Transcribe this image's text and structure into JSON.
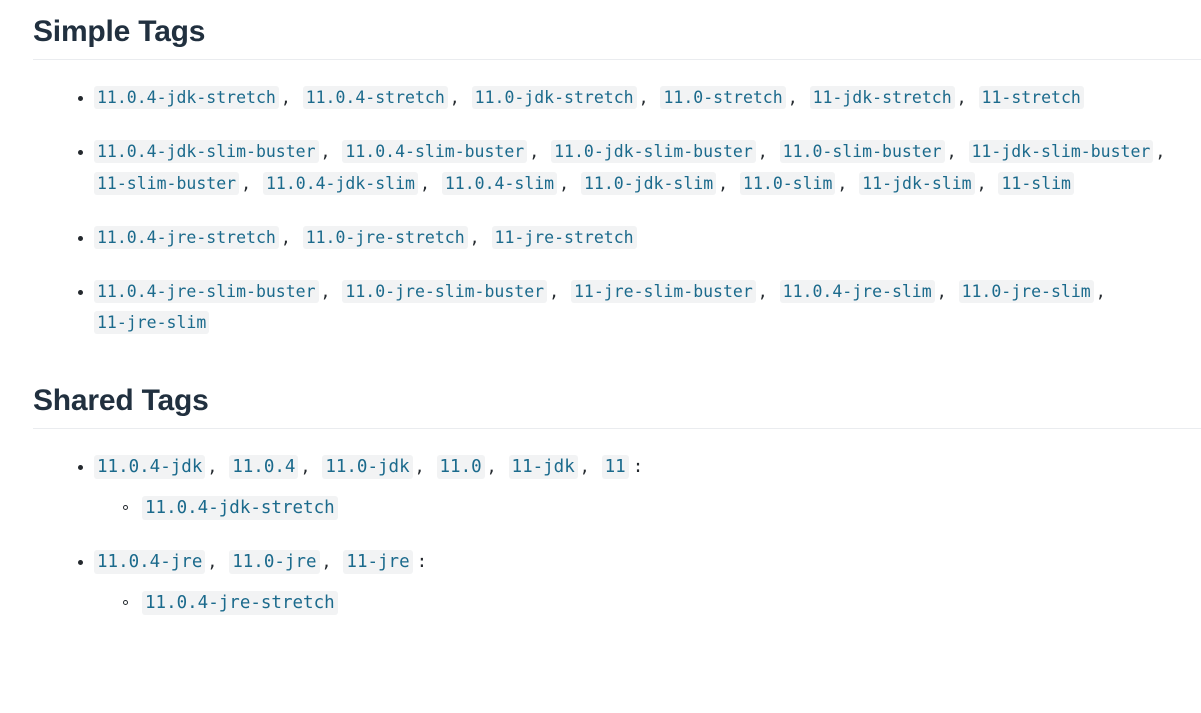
{
  "sections": [
    {
      "id": "simple-tags",
      "heading": "Simple Tags",
      "groups": [
        {
          "tags": [
            "11.0.4-jdk-stretch",
            "11.0.4-stretch",
            "11.0-jdk-stretch",
            "11.0-stretch",
            "11-jdk-stretch",
            "11-stretch"
          ]
        },
        {
          "tags": [
            "11.0.4-jdk-slim-buster",
            "11.0.4-slim-buster",
            "11.0-jdk-slim-buster",
            "11.0-slim-buster",
            "11-jdk-slim-buster",
            "11-slim-buster",
            "11.0.4-jdk-slim",
            "11.0.4-slim",
            "11.0-jdk-slim",
            "11.0-slim",
            "11-jdk-slim",
            "11-slim"
          ]
        },
        {
          "tags": [
            "11.0.4-jre-stretch",
            "11.0-jre-stretch",
            "11-jre-stretch"
          ]
        },
        {
          "tags": [
            "11.0.4-jre-slim-buster",
            "11.0-jre-slim-buster",
            "11-jre-slim-buster",
            "11.0.4-jre-slim",
            "11.0-jre-slim",
            "11-jre-slim"
          ]
        }
      ]
    },
    {
      "id": "shared-tags",
      "heading": "Shared Tags",
      "groups": [
        {
          "tags": [
            "11.0.4-jdk",
            "11.0.4",
            "11.0-jdk",
            "11.0",
            "11-jdk",
            "11"
          ],
          "suffix": ":",
          "children": [
            "11.0.4-jdk-stretch"
          ]
        },
        {
          "tags": [
            "11.0.4-jre",
            "11.0-jre",
            "11-jre"
          ],
          "suffix": ":",
          "children": [
            "11.0.4-jre-stretch"
          ]
        }
      ]
    }
  ],
  "separator": ",",
  "colors": {
    "heading": "#21303f",
    "code_text": "#1b6a8c",
    "code_background": "#f2f3f4",
    "divider": "#eaecef",
    "body_text": "#24292e",
    "page_background": "#ffffff"
  }
}
